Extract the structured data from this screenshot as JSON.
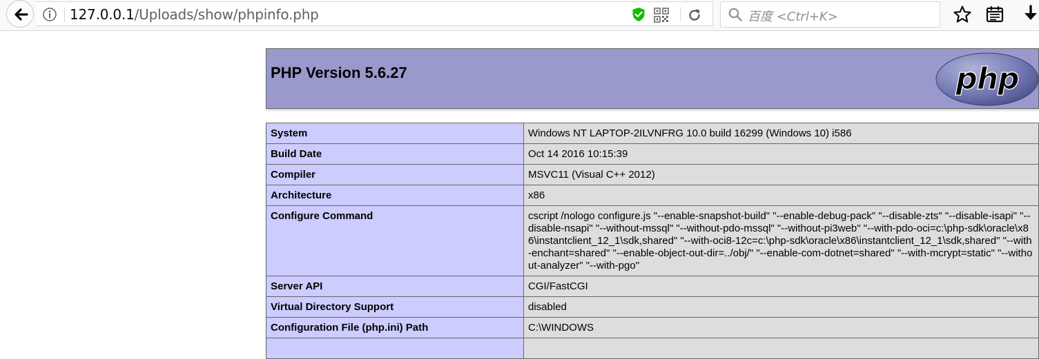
{
  "browser": {
    "url_host": "127.0.0.1",
    "url_path": "/Uploads/show/phpinfo.php",
    "search_placeholder": "百度 <Ctrl+K>"
  },
  "page": {
    "title": "PHP Version 5.6.27",
    "logo_text": "php"
  },
  "info_rows": [
    {
      "key": "System",
      "value": "Windows NT LAPTOP-2ILVNFRG 10.0 build 16299 (Windows 10) i586"
    },
    {
      "key": "Build Date",
      "value": "Oct 14 2016 10:15:39"
    },
    {
      "key": "Compiler",
      "value": "MSVC11 (Visual C++ 2012)"
    },
    {
      "key": "Architecture",
      "value": "x86"
    },
    {
      "key": "Configure Command",
      "value": "cscript /nologo configure.js \"--enable-snapshot-build\" \"--enable-debug-pack\" \"--disable-zts\" \"--disable-isapi\" \"--disable-nsapi\" \"--without-mssql\" \"--without-pdo-mssql\" \"--without-pi3web\" \"--with-pdo-oci=c:\\php-sdk\\oracle\\x86\\instantclient_12_1\\sdk,shared\" \"--with-oci8-12c=c:\\php-sdk\\oracle\\x86\\instantclient_12_1\\sdk,shared\" \"--with-enchant=shared\" \"--enable-object-out-dir=../obj/\" \"--enable-com-dotnet=shared\" \"--with-mcrypt=static\" \"--without-analyzer\" \"--with-pgo\""
    },
    {
      "key": "Server API",
      "value": "CGI/FastCGI"
    },
    {
      "key": "Virtual Directory Support",
      "value": "disabled"
    },
    {
      "key": "Configuration File (php.ini) Path",
      "value": "C:\\WINDOWS"
    },
    {
      "key": "",
      "value": ""
    }
  ],
  "colors": {
    "header_bg": "#9999cc",
    "key_cell_bg": "#ccccff",
    "value_cell_bg": "#dddddd",
    "shield_green": "#12bc00"
  }
}
